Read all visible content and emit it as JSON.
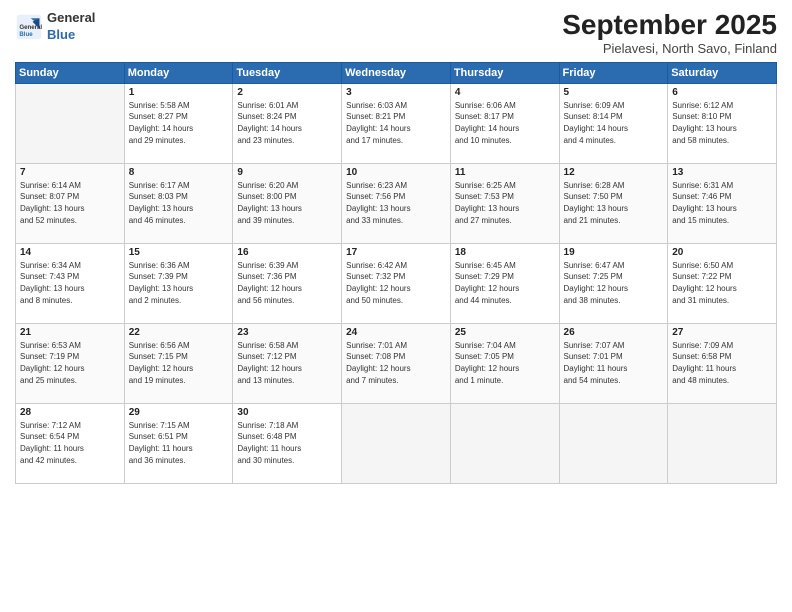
{
  "header": {
    "logo_line1": "General",
    "logo_line2": "Blue",
    "month": "September 2025",
    "location": "Pielavesi, North Savo, Finland"
  },
  "days_of_week": [
    "Sunday",
    "Monday",
    "Tuesday",
    "Wednesday",
    "Thursday",
    "Friday",
    "Saturday"
  ],
  "weeks": [
    [
      {
        "num": "",
        "info": ""
      },
      {
        "num": "1",
        "info": "Sunrise: 5:58 AM\nSunset: 8:27 PM\nDaylight: 14 hours\nand 29 minutes."
      },
      {
        "num": "2",
        "info": "Sunrise: 6:01 AM\nSunset: 8:24 PM\nDaylight: 14 hours\nand 23 minutes."
      },
      {
        "num": "3",
        "info": "Sunrise: 6:03 AM\nSunset: 8:21 PM\nDaylight: 14 hours\nand 17 minutes."
      },
      {
        "num": "4",
        "info": "Sunrise: 6:06 AM\nSunset: 8:17 PM\nDaylight: 14 hours\nand 10 minutes."
      },
      {
        "num": "5",
        "info": "Sunrise: 6:09 AM\nSunset: 8:14 PM\nDaylight: 14 hours\nand 4 minutes."
      },
      {
        "num": "6",
        "info": "Sunrise: 6:12 AM\nSunset: 8:10 PM\nDaylight: 13 hours\nand 58 minutes."
      }
    ],
    [
      {
        "num": "7",
        "info": "Sunrise: 6:14 AM\nSunset: 8:07 PM\nDaylight: 13 hours\nand 52 minutes."
      },
      {
        "num": "8",
        "info": "Sunrise: 6:17 AM\nSunset: 8:03 PM\nDaylight: 13 hours\nand 46 minutes."
      },
      {
        "num": "9",
        "info": "Sunrise: 6:20 AM\nSunset: 8:00 PM\nDaylight: 13 hours\nand 39 minutes."
      },
      {
        "num": "10",
        "info": "Sunrise: 6:23 AM\nSunset: 7:56 PM\nDaylight: 13 hours\nand 33 minutes."
      },
      {
        "num": "11",
        "info": "Sunrise: 6:25 AM\nSunset: 7:53 PM\nDaylight: 13 hours\nand 27 minutes."
      },
      {
        "num": "12",
        "info": "Sunrise: 6:28 AM\nSunset: 7:50 PM\nDaylight: 13 hours\nand 21 minutes."
      },
      {
        "num": "13",
        "info": "Sunrise: 6:31 AM\nSunset: 7:46 PM\nDaylight: 13 hours\nand 15 minutes."
      }
    ],
    [
      {
        "num": "14",
        "info": "Sunrise: 6:34 AM\nSunset: 7:43 PM\nDaylight: 13 hours\nand 8 minutes."
      },
      {
        "num": "15",
        "info": "Sunrise: 6:36 AM\nSunset: 7:39 PM\nDaylight: 13 hours\nand 2 minutes."
      },
      {
        "num": "16",
        "info": "Sunrise: 6:39 AM\nSunset: 7:36 PM\nDaylight: 12 hours\nand 56 minutes."
      },
      {
        "num": "17",
        "info": "Sunrise: 6:42 AM\nSunset: 7:32 PM\nDaylight: 12 hours\nand 50 minutes."
      },
      {
        "num": "18",
        "info": "Sunrise: 6:45 AM\nSunset: 7:29 PM\nDaylight: 12 hours\nand 44 minutes."
      },
      {
        "num": "19",
        "info": "Sunrise: 6:47 AM\nSunset: 7:25 PM\nDaylight: 12 hours\nand 38 minutes."
      },
      {
        "num": "20",
        "info": "Sunrise: 6:50 AM\nSunset: 7:22 PM\nDaylight: 12 hours\nand 31 minutes."
      }
    ],
    [
      {
        "num": "21",
        "info": "Sunrise: 6:53 AM\nSunset: 7:19 PM\nDaylight: 12 hours\nand 25 minutes."
      },
      {
        "num": "22",
        "info": "Sunrise: 6:56 AM\nSunset: 7:15 PM\nDaylight: 12 hours\nand 19 minutes."
      },
      {
        "num": "23",
        "info": "Sunrise: 6:58 AM\nSunset: 7:12 PM\nDaylight: 12 hours\nand 13 minutes."
      },
      {
        "num": "24",
        "info": "Sunrise: 7:01 AM\nSunset: 7:08 PM\nDaylight: 12 hours\nand 7 minutes."
      },
      {
        "num": "25",
        "info": "Sunrise: 7:04 AM\nSunset: 7:05 PM\nDaylight: 12 hours\nand 1 minute."
      },
      {
        "num": "26",
        "info": "Sunrise: 7:07 AM\nSunset: 7:01 PM\nDaylight: 11 hours\nand 54 minutes."
      },
      {
        "num": "27",
        "info": "Sunrise: 7:09 AM\nSunset: 6:58 PM\nDaylight: 11 hours\nand 48 minutes."
      }
    ],
    [
      {
        "num": "28",
        "info": "Sunrise: 7:12 AM\nSunset: 6:54 PM\nDaylight: 11 hours\nand 42 minutes."
      },
      {
        "num": "29",
        "info": "Sunrise: 7:15 AM\nSunset: 6:51 PM\nDaylight: 11 hours\nand 36 minutes."
      },
      {
        "num": "30",
        "info": "Sunrise: 7:18 AM\nSunset: 6:48 PM\nDaylight: 11 hours\nand 30 minutes."
      },
      {
        "num": "",
        "info": ""
      },
      {
        "num": "",
        "info": ""
      },
      {
        "num": "",
        "info": ""
      },
      {
        "num": "",
        "info": ""
      }
    ]
  ]
}
